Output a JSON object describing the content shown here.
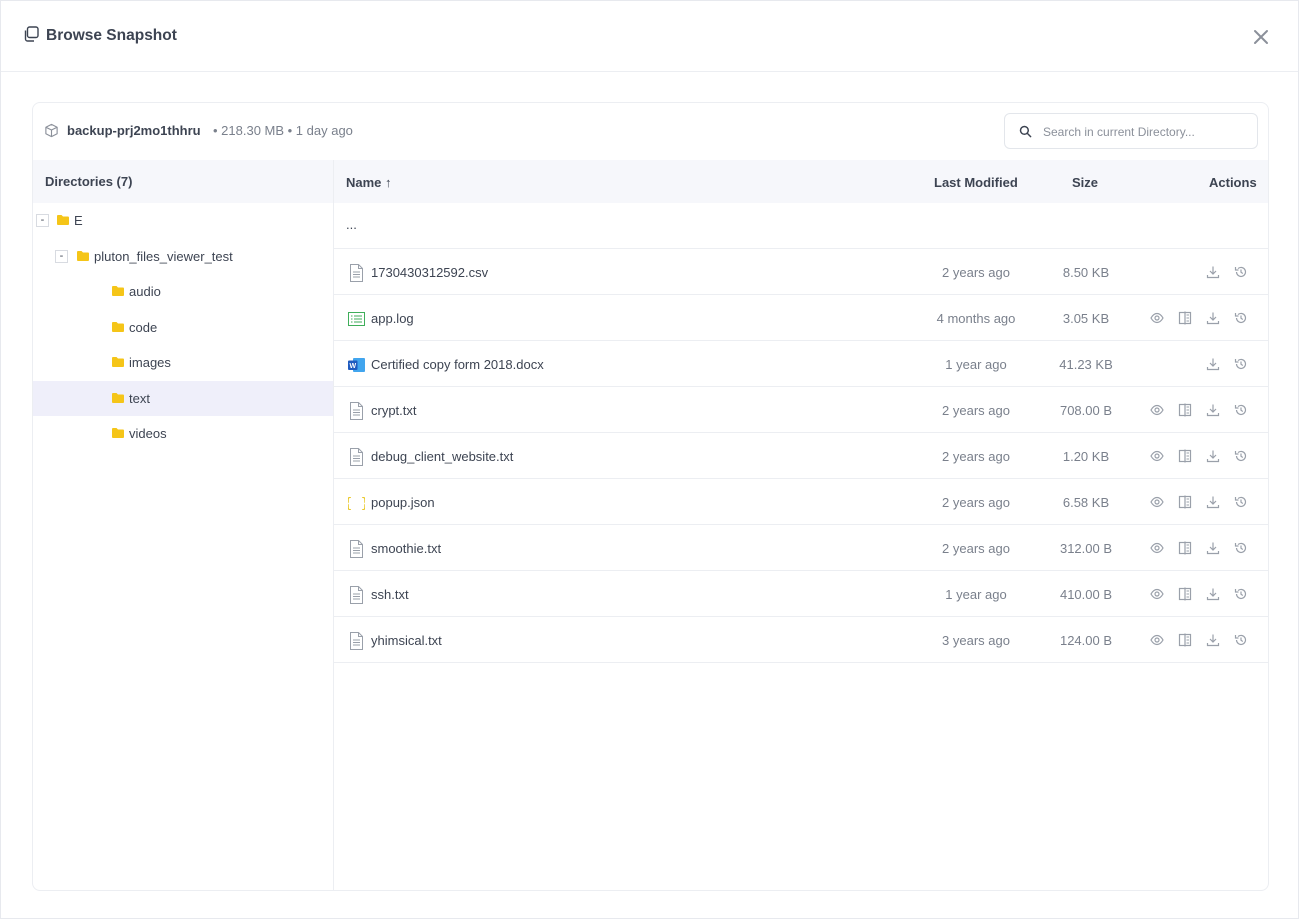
{
  "modal": {
    "title": "Browse Snapshot"
  },
  "snapshot": {
    "name": "backup-prj2mo1thhru",
    "meta": "• 218.30 MB • 1 day ago"
  },
  "search": {
    "placeholder": "Search in current Directory..."
  },
  "tree": {
    "heading": "Directories (7)",
    "nodes": [
      {
        "label": "E",
        "toggle": "-"
      },
      {
        "label": "pluton_files_viewer_test",
        "toggle": "-"
      },
      {
        "label": "audio"
      },
      {
        "label": "code"
      },
      {
        "label": "images"
      },
      {
        "label": "text",
        "selected": true
      },
      {
        "label": "videos"
      }
    ]
  },
  "files": {
    "headers": {
      "name": "Name ↑",
      "modified": "Last Modified",
      "size": "Size",
      "actions": "Actions"
    },
    "parent_label": "...",
    "rows": [
      {
        "name": "1730430312592.csv",
        "modified": "2 years ago",
        "size": "8.50 KB",
        "icon": "text-file-icon",
        "preview": false
      },
      {
        "name": "app.log",
        "modified": "4 months ago",
        "size": "3.05 KB",
        "icon": "log-file-icon",
        "preview": true
      },
      {
        "name": "Certified copy form 2018.docx",
        "modified": "1 year ago",
        "size": "41.23 KB",
        "icon": "word-file-icon",
        "preview": false
      },
      {
        "name": "crypt.txt",
        "modified": "2 years ago",
        "size": "708.00 B",
        "icon": "text-file-icon",
        "preview": true
      },
      {
        "name": "debug_client_website.txt",
        "modified": "2 years ago",
        "size": "1.20 KB",
        "icon": "text-file-icon",
        "preview": true
      },
      {
        "name": "popup.json",
        "modified": "2 years ago",
        "size": "6.58 KB",
        "icon": "json-file-icon",
        "preview": true
      },
      {
        "name": "smoothie.txt",
        "modified": "2 years ago",
        "size": "312.00 B",
        "icon": "text-file-icon",
        "preview": true
      },
      {
        "name": "ssh.txt",
        "modified": "1 year ago",
        "size": "410.00 B",
        "icon": "text-file-icon",
        "preview": true
      },
      {
        "name": "yhimsical.txt",
        "modified": "3 years ago",
        "size": "124.00 B",
        "icon": "text-file-icon",
        "preview": true
      }
    ]
  },
  "colors": {
    "folder": "#f5c518",
    "selected_bg": "#efeffa",
    "header_bg": "#f6f7fb",
    "log_icon": "#3fae5a",
    "word_icon": "#1f5bbf",
    "json_icon": "#e8c51c"
  }
}
